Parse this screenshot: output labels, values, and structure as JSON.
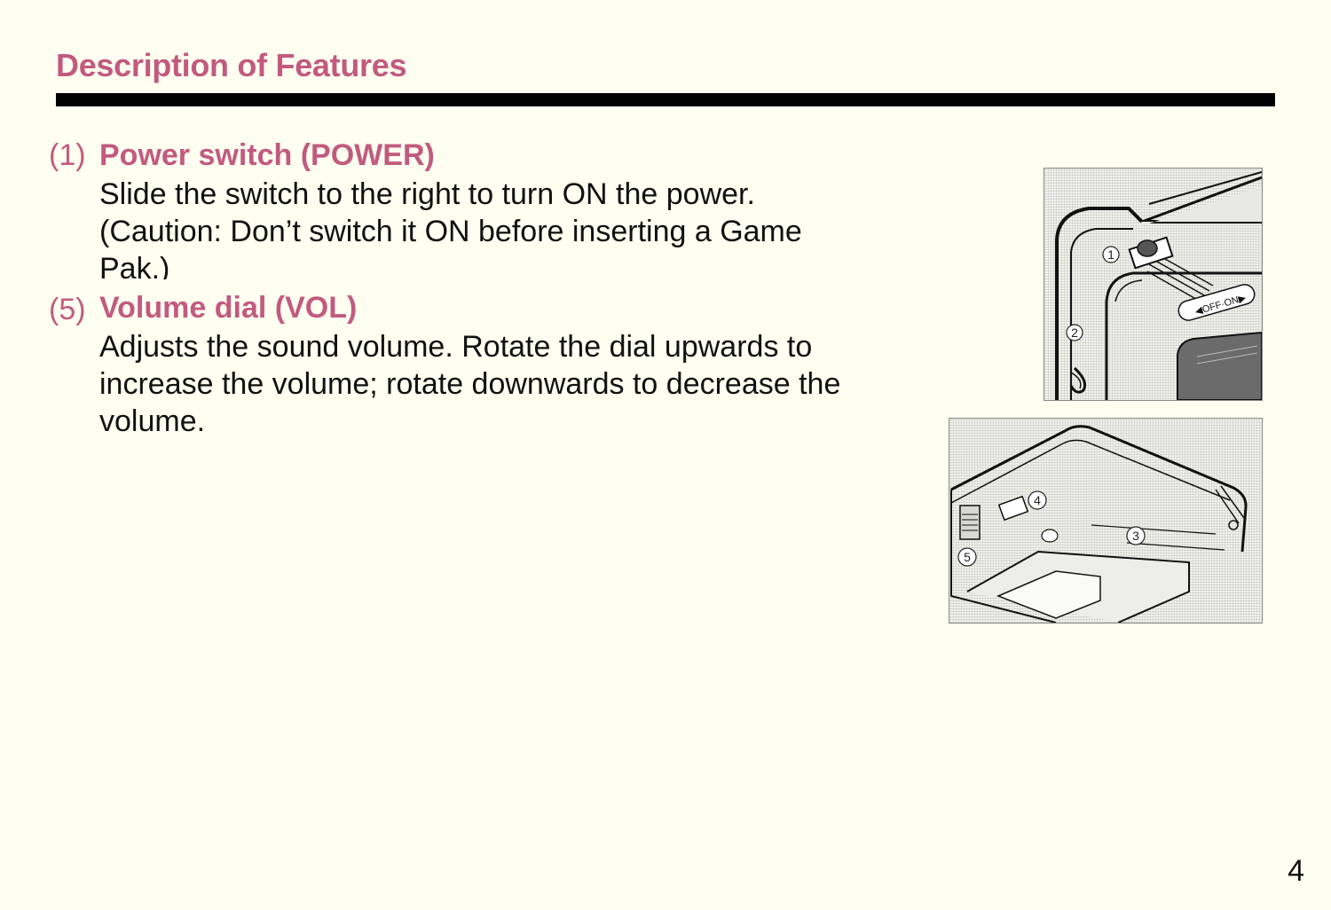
{
  "page": {
    "section_title": "Description of Features",
    "page_number": "4"
  },
  "features": [
    {
      "number": "(1)",
      "title": "Power switch (POWER)",
      "lines": [
        "Slide the switch to the right to turn ON the power.",
        "(Caution: Don’t switch it ON before inserting a Game",
        "Pak.)"
      ]
    },
    {
      "number": "(5)",
      "title": "Volume dial (VOL)",
      "lines": [
        "Adjusts the sound volume. Rotate the dial upwards to",
        "increase the volume; rotate downwards to decrease the",
        "volume."
      ]
    }
  ],
  "figures": {
    "top": {
      "switch_label": "◀OFF·ON▶",
      "callouts": [
        "1",
        "2"
      ]
    },
    "bottom": {
      "callouts": [
        "3",
        "4",
        "5"
      ]
    }
  }
}
